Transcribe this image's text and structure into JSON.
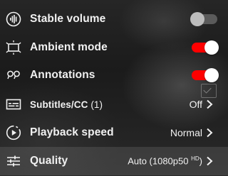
{
  "menu": {
    "items": [
      {
        "label": "Stable volume",
        "control": "toggle",
        "on": false,
        "icon": "stable-volume-icon"
      },
      {
        "label": "Ambient mode",
        "control": "toggle",
        "on": true,
        "icon": "ambient-mode-icon"
      },
      {
        "label": "Annotations",
        "control": "toggle",
        "on": true,
        "icon": "annotations-icon"
      },
      {
        "label": "Subtitles/CC",
        "label_suffix": " (1)",
        "value": "Off",
        "control": "submenu",
        "icon": "subtitles-icon"
      },
      {
        "label": "Playback speed",
        "value": "Normal",
        "control": "submenu",
        "icon": "playback-speed-icon"
      },
      {
        "label": "Quality",
        "value": "Auto (1080p50 ",
        "value_sup": "HD",
        "value_suffix": ")",
        "control": "submenu",
        "icon": "quality-icon",
        "highlighted": true
      }
    ]
  },
  "colors": {
    "toggle_on": "#ff0000",
    "toggle_off": "#5b5b5b",
    "text": "#f1f1f1"
  }
}
